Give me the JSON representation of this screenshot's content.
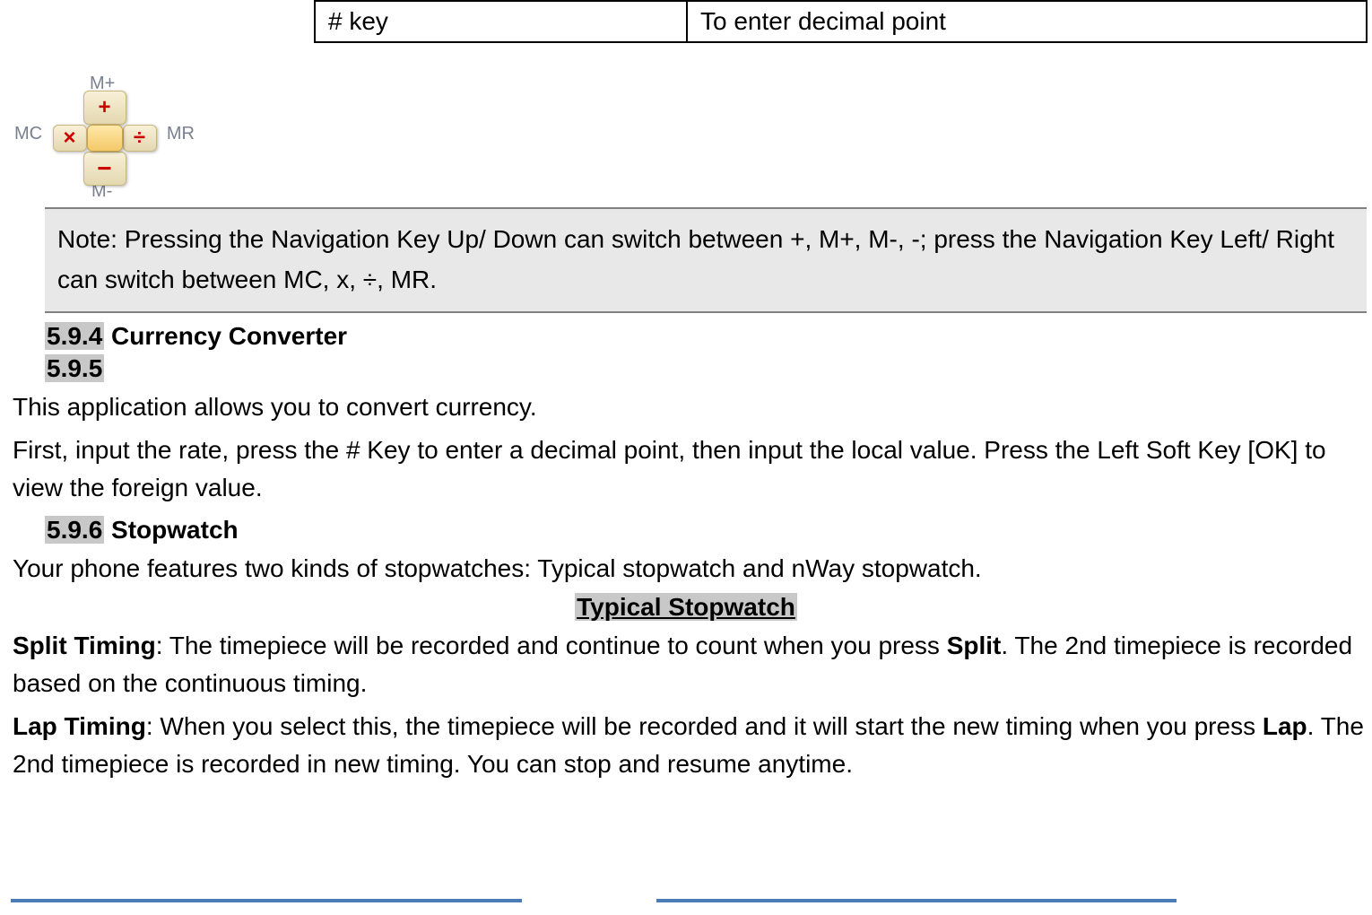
{
  "table": {
    "left": "# key",
    "right": "To enter decimal point"
  },
  "calc": {
    "mp": "M+",
    "mm": "M-",
    "mc": "MC",
    "mr": "MR",
    "plus": "+",
    "minus": "−",
    "mult": "×",
    "div": "÷"
  },
  "note": "Note: Pressing the Navigation Key Up/ Down can switch between +, M+, M-, -; press the Navigation Key Left/ Right can switch between MC, x, ÷, MR.",
  "sec594_num": "5.9.4",
  "sec594_title": " Currency Converter",
  "sec595_num": "5.9.5",
  "currency_p1": "This application allows you to convert currency.",
  "currency_p2": "First, input the rate, press the # Key to enter a decimal point, then input the local value. Press the Left Soft Key [OK] to view the foreign value.",
  "sec596_num": "5.9.6",
  "sec596_title": " Stopwatch",
  "stopwatch_intro": "Your phone features two kinds of stopwatches: Typical stopwatch and nWay stopwatch.",
  "typical_heading": "Typical Stopwatch",
  "split": {
    "label": "Split Timing",
    "t1": ": The timepiece will be recorded and continue to count when you press ",
    "bold": "Split",
    "t2": ". The 2nd timepiece is recorded based on the continuous timing."
  },
  "lap": {
    "label": "Lap Timing",
    "t1": ": When you select this, the timepiece will be recorded and it will start the new timing when you press ",
    "bold": "Lap",
    "t2": ". The 2nd timepiece is recorded in new timing. You can stop and resume anytime."
  }
}
